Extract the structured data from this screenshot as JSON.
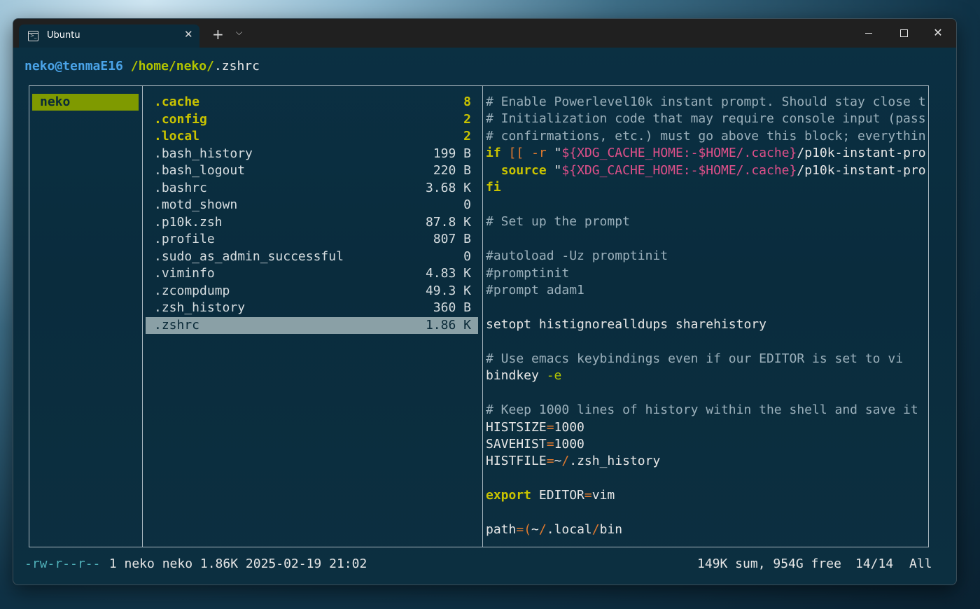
{
  "window": {
    "tab_title": "Ubuntu",
    "tab_close": "✕",
    "new_tab": "+",
    "tab_menu": "⌵",
    "close": "✕"
  },
  "prompt": {
    "user_host": "neko@tenmaE16",
    "path": "/home/neko/",
    "file": ".zshrc"
  },
  "parent_column": {
    "selected": "neko"
  },
  "files": [
    {
      "name": ".cache",
      "size": "8",
      "type": "dir"
    },
    {
      "name": ".config",
      "size": "2",
      "type": "dir"
    },
    {
      "name": ".local",
      "size": "2",
      "type": "dir"
    },
    {
      "name": ".bash_history",
      "size": "199 B",
      "type": "file"
    },
    {
      "name": ".bash_logout",
      "size": "220 B",
      "type": "file"
    },
    {
      "name": ".bashrc",
      "size": "3.68 K",
      "type": "file"
    },
    {
      "name": ".motd_shown",
      "size": "0",
      "type": "file"
    },
    {
      "name": ".p10k.zsh",
      "size": "87.8 K",
      "type": "file"
    },
    {
      "name": ".profile",
      "size": "807 B",
      "type": "file"
    },
    {
      "name": ".sudo_as_admin_successful",
      "size": "0",
      "type": "file"
    },
    {
      "name": ".viminfo",
      "size": "4.83 K",
      "type": "file"
    },
    {
      "name": ".zcompdump",
      "size": "49.3 K",
      "type": "file"
    },
    {
      "name": ".zsh_history",
      "size": "360 B",
      "type": "file"
    },
    {
      "name": ".zshrc",
      "size": "1.86 K",
      "type": "file",
      "selected": true
    }
  ],
  "preview_lines": [
    [
      {
        "t": "# Enable Powerlevel10k instant prompt. Should stay close t",
        "c": "com"
      }
    ],
    [
      {
        "t": "# Initialization code that may require console input (pass",
        "c": "com"
      }
    ],
    [
      {
        "t": "# confirmations, etc.) must go above this block; everythin",
        "c": "com"
      }
    ],
    [
      {
        "t": "if",
        "c": "yellow"
      },
      {
        "t": " ",
        "c": "white"
      },
      {
        "t": "[[",
        "c": "orange"
      },
      {
        "t": " ",
        "c": "white"
      },
      {
        "t": "-r",
        "c": "orange"
      },
      {
        "t": " \"",
        "c": "white"
      },
      {
        "t": "${XDG_CACHE_HOME:-$HOME/.cache}",
        "c": "pink"
      },
      {
        "t": "/p10k-instant-pro",
        "c": "white"
      }
    ],
    [
      {
        "t": "  ",
        "c": "white"
      },
      {
        "t": "source",
        "c": "yellow"
      },
      {
        "t": " \"",
        "c": "white"
      },
      {
        "t": "${XDG_CACHE_HOME:-$HOME/.cache}",
        "c": "pink"
      },
      {
        "t": "/p10k-instant-pro",
        "c": "white"
      }
    ],
    [
      {
        "t": "fi",
        "c": "yellow"
      }
    ],
    [],
    [
      {
        "t": "# Set up the prompt",
        "c": "com"
      }
    ],
    [],
    [
      {
        "t": "#autoload -Uz promptinit",
        "c": "com"
      }
    ],
    [
      {
        "t": "#promptinit",
        "c": "com"
      }
    ],
    [
      {
        "t": "#prompt adam1",
        "c": "com"
      }
    ],
    [],
    [
      {
        "t": "setopt histignorealldups sharehistory",
        "c": "white"
      }
    ],
    [],
    [
      {
        "t": "# Use emacs keybindings even if our EDITOR is set to vi",
        "c": "com"
      }
    ],
    [
      {
        "t": "bindkey ",
        "c": "white"
      },
      {
        "t": "-e",
        "c": "green"
      }
    ],
    [],
    [
      {
        "t": "# Keep 1000 lines of history within the shell and save it",
        "c": "com"
      }
    ],
    [
      {
        "t": "HISTSIZE",
        "c": "white"
      },
      {
        "t": "=",
        "c": "orange"
      },
      {
        "t": "1000",
        "c": "white"
      }
    ],
    [
      {
        "t": "SAVEHIST",
        "c": "white"
      },
      {
        "t": "=",
        "c": "orange"
      },
      {
        "t": "1000",
        "c": "white"
      }
    ],
    [
      {
        "t": "HISTFILE",
        "c": "white"
      },
      {
        "t": "=",
        "c": "orange"
      },
      {
        "t": "~",
        "c": "white"
      },
      {
        "t": "/",
        "c": "orange"
      },
      {
        "t": ".zsh_history",
        "c": "white"
      }
    ],
    [],
    [
      {
        "t": "export",
        "c": "yellow"
      },
      {
        "t": " EDITOR",
        "c": "white"
      },
      {
        "t": "=",
        "c": "orange"
      },
      {
        "t": "vim",
        "c": "white"
      }
    ],
    [],
    [
      {
        "t": "path",
        "c": "white"
      },
      {
        "t": "=(",
        "c": "orange"
      },
      {
        "t": "~",
        "c": "white"
      },
      {
        "t": "/",
        "c": "orange"
      },
      {
        "t": ".local",
        "c": "white"
      },
      {
        "t": "/",
        "c": "orange"
      },
      {
        "t": "bin",
        "c": "white"
      }
    ]
  ],
  "status": {
    "permissions": "-rw-r--r--",
    "info": " 1 neko neko 1.86K 2025-02-19 21:02",
    "disk": "149K sum, 954G free",
    "position": "14/14",
    "scroll": "All"
  },
  "colors": {
    "dir": "#c9c300",
    "selected_parent_bg": "#7f9a00",
    "selected_file_bg": "#8aa0a6",
    "comment": "#9bb0bb",
    "keyword": "#c9c300",
    "operator": "#e0792e",
    "string_var": "#e0508a"
  }
}
